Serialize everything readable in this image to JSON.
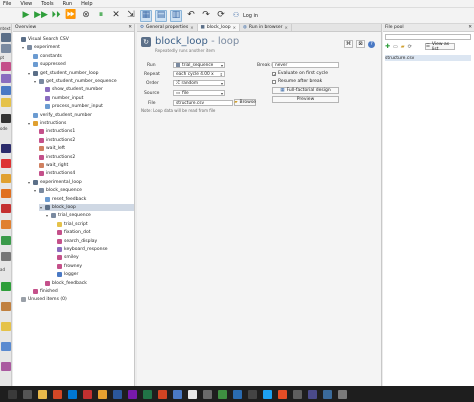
{
  "menu": [
    "File",
    "View",
    "Tools",
    "Run",
    "Help"
  ],
  "toolbar": {
    "login_label": "Log in"
  },
  "sidestrip": {
    "labels": [
      "ntext",
      "pt",
      "ode",
      "ad"
    ]
  },
  "overview": {
    "title": "Overview",
    "nodes": [
      {
        "label": "Visual Search CSV",
        "depth": 0,
        "color": "#5b6f88",
        "expander": ""
      },
      {
        "label": "experiment",
        "depth": 1,
        "color": "#7a8aa0",
        "expander": "▾"
      },
      {
        "label": "constants",
        "depth": 2,
        "color": "#6b9bd1",
        "expander": ""
      },
      {
        "label": "suppressed",
        "depth": 2,
        "color": "#6b9bd1",
        "expander": ""
      },
      {
        "label": "get_student_number_loop",
        "depth": 2,
        "color": "#5b6f88",
        "expander": "▾"
      },
      {
        "label": "get_student_number_sequence",
        "depth": 3,
        "color": "#7a8aa0",
        "expander": "▾"
      },
      {
        "label": "show_student_number",
        "depth": 4,
        "color": "#8a6dbf",
        "expander": ""
      },
      {
        "label": "number_input",
        "depth": 4,
        "color": "#8a6dbf",
        "expander": ""
      },
      {
        "label": "process_number_input",
        "depth": 4,
        "color": "#6b9bd1",
        "expander": ""
      },
      {
        "label": "verify_student_number",
        "depth": 2,
        "color": "#6b9bd1",
        "expander": ""
      },
      {
        "label": "instructions",
        "depth": 2,
        "color": "#e0a030",
        "expander": "▾"
      },
      {
        "label": "instructions1",
        "depth": 3,
        "color": "#c4508a",
        "expander": ""
      },
      {
        "label": "instructions2",
        "depth": 3,
        "color": "#c4508a",
        "expander": ""
      },
      {
        "label": "wait_left",
        "depth": 3,
        "color": "#d08060",
        "expander": ""
      },
      {
        "label": "instructions2",
        "depth": 3,
        "color": "#c4508a",
        "expander": ""
      },
      {
        "label": "wait_right",
        "depth": 3,
        "color": "#d08060",
        "expander": ""
      },
      {
        "label": "instructions4",
        "depth": 3,
        "color": "#c4508a",
        "expander": ""
      },
      {
        "label": "experimental_loop",
        "depth": 2,
        "color": "#5b6f88",
        "expander": "▾"
      },
      {
        "label": "block_sequence",
        "depth": 3,
        "color": "#7a8aa0",
        "expander": "▾"
      },
      {
        "label": "reset_feedback",
        "depth": 4,
        "color": "#6b9bd1",
        "expander": ""
      },
      {
        "label": "block_loop",
        "depth": 4,
        "color": "#5b6f88",
        "expander": "▾",
        "selected": true
      },
      {
        "label": "trial_sequence",
        "depth": 5,
        "color": "#7a8aa0",
        "expander": "▾"
      },
      {
        "label": "trial_script",
        "depth": 6,
        "color": "#e5c24a",
        "expander": ""
      },
      {
        "label": "fixation_dot",
        "depth": 6,
        "color": "#c4508a",
        "expander": ""
      },
      {
        "label": "search_display",
        "depth": 6,
        "color": "#c4508a",
        "expander": ""
      },
      {
        "label": "keyboard_response",
        "depth": 6,
        "color": "#8a6dbf",
        "expander": ""
      },
      {
        "label": "smiley",
        "depth": 6,
        "color": "#c4508a",
        "expander": ""
      },
      {
        "label": "frowney",
        "depth": 6,
        "color": "#c4508a",
        "expander": ""
      },
      {
        "label": "logger",
        "depth": 6,
        "color": "#4a79c4",
        "expander": ""
      },
      {
        "label": "block_feedback",
        "depth": 4,
        "color": "#c4508a",
        "expander": ""
      },
      {
        "label": "finished",
        "depth": 2,
        "color": "#c4508a",
        "expander": ""
      },
      {
        "label": "Unused items (0)",
        "depth": 0,
        "color": "#9aa0a8",
        "expander": ""
      }
    ]
  },
  "tabs": [
    {
      "label": "General properties",
      "active": false
    },
    {
      "label": "block_loop",
      "active": true
    },
    {
      "label": "Run in browser",
      "active": false
    }
  ],
  "editor": {
    "title": "block_loop",
    "title_suffix": " - loop",
    "subtitle": "Repeatedly runs another item",
    "run_label": "Run",
    "run_value": "trial_sequence",
    "repeat_label": "Repeat",
    "repeat_value": "each cycle 4.00 x",
    "order_label": "Order",
    "order_value": "random",
    "source_label": "Source",
    "source_value": "file",
    "file_label": "File",
    "file_value": "structure.csv",
    "browse_label": "Browse",
    "break_label": "Break if",
    "break_value": "never",
    "evaluate_label": "Evaluate on first cycle",
    "resume_label": "Resume after break",
    "fullfactorial_label": "Full-factorial design",
    "preview_label": "Preview",
    "note": "Note: Loop data will be read from file"
  },
  "filepool": {
    "title": "File pool",
    "search_placeholder": "",
    "view_as_list_label": "View as list",
    "files": [
      "structure.csv"
    ]
  }
}
